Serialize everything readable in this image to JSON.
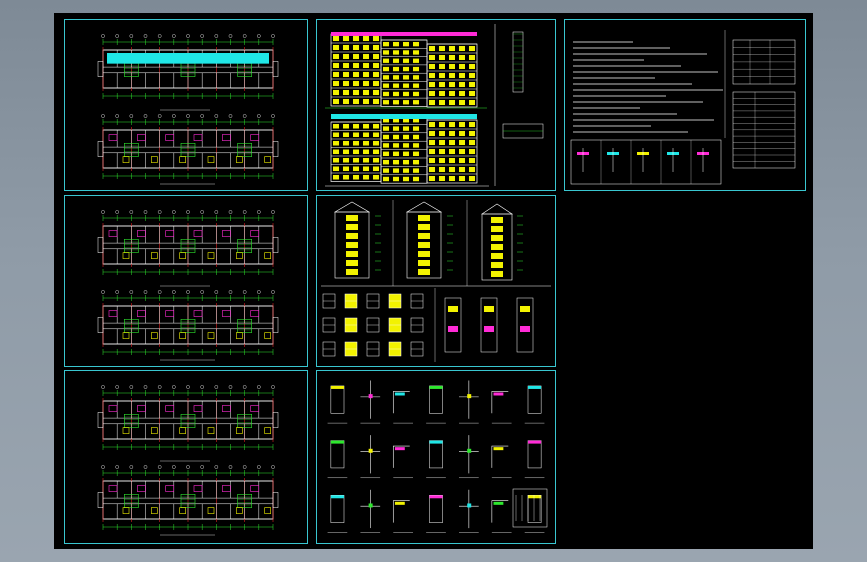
{
  "app": {
    "title": "",
    "background_color": "#8c98a4",
    "canvas_color": "#000000"
  },
  "colors": {
    "frame": "#39c6d0",
    "line_white": "#ffffff",
    "line_green": "#2ee82e",
    "line_red": "#e02020",
    "fill_yellow": "#f2f200",
    "fill_cyan": "#20e6e6",
    "fill_magenta": "#ff2bd6",
    "line_blue": "#3a66ff"
  },
  "sheets": [
    {
      "id": "floor-plans-1",
      "kind": "floor-plans",
      "label": ""
    },
    {
      "id": "elevations-front",
      "kind": "elevation",
      "label": ""
    },
    {
      "id": "design-notes",
      "kind": "notes-table",
      "label": ""
    },
    {
      "id": "floor-plans-2",
      "kind": "floor-plans",
      "label": ""
    },
    {
      "id": "elevations-side-details",
      "kind": "elevation-details",
      "label": ""
    },
    {
      "id": "floor-plans-3",
      "kind": "floor-plans",
      "label": ""
    },
    {
      "id": "construction-details",
      "kind": "details",
      "label": ""
    }
  ]
}
